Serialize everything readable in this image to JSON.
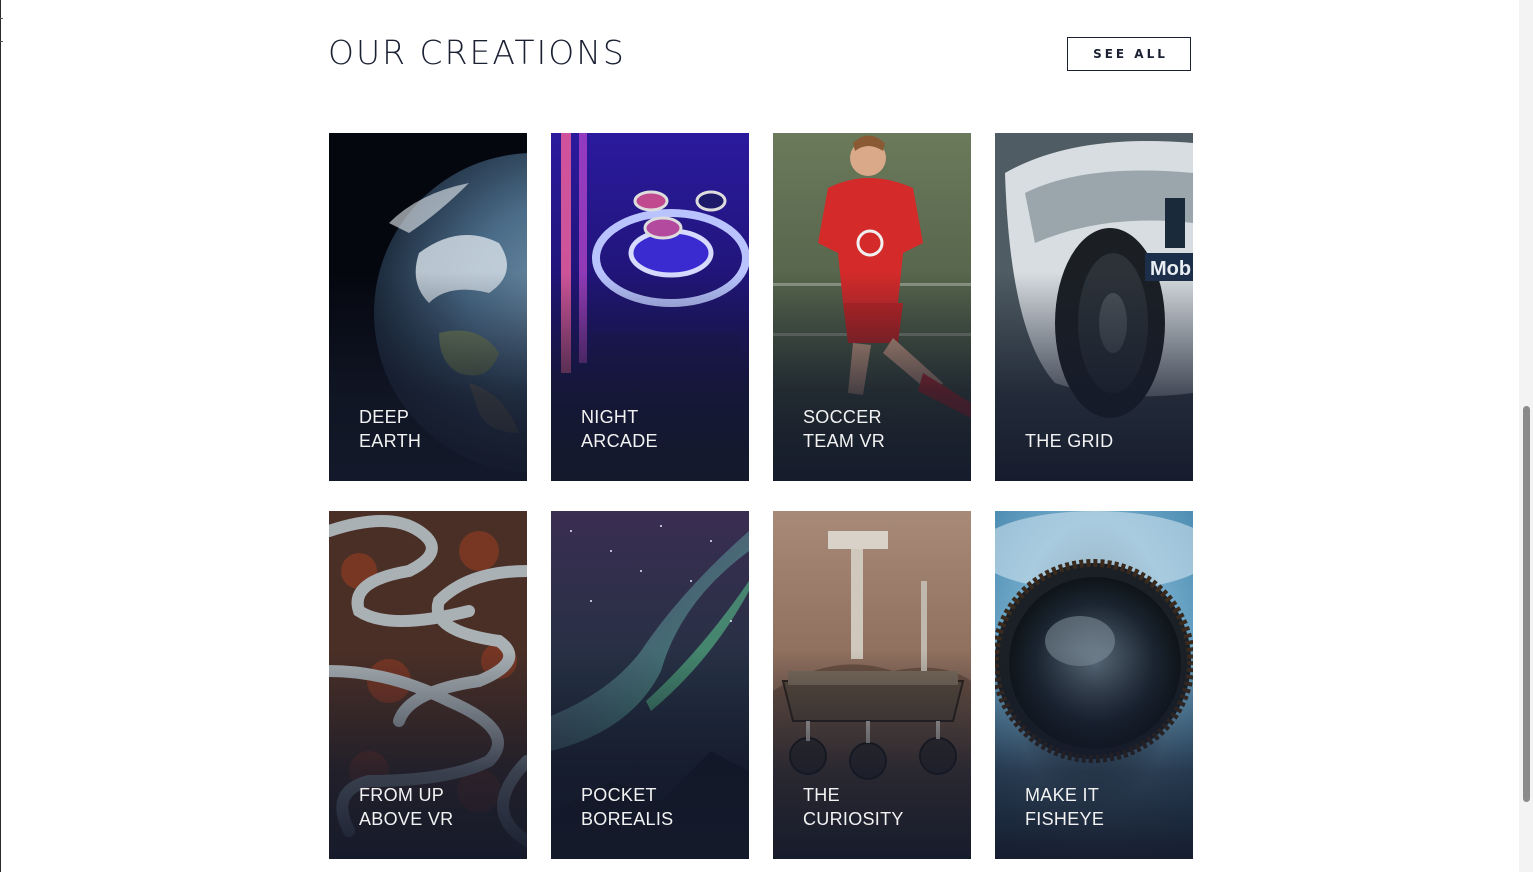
{
  "section": {
    "title": "OUR CREATIONS",
    "see_all_label": "SEE ALL"
  },
  "cards": [
    {
      "line1": "DEEP",
      "line2": "EARTH",
      "image": "earth-from-space"
    },
    {
      "line1": "NIGHT",
      "line2": "ARCADE",
      "image": "skeeball-arcade"
    },
    {
      "line1": "SOCCER",
      "line2": "TEAM VR",
      "image": "soccer-player"
    },
    {
      "line1": "",
      "line2": "THE GRID",
      "image": "race-car"
    },
    {
      "line1": "FROM UP",
      "line2": "ABOVE VR",
      "image": "aerial-winding-road"
    },
    {
      "line1": "POCKET",
      "line2": "BOREALIS",
      "image": "aurora-borealis"
    },
    {
      "line1": "THE",
      "line2": "CURIOSITY",
      "image": "mars-rover"
    },
    {
      "line1": "MAKE IT",
      "line2": "FISHEYE",
      "image": "fisheye-planet"
    }
  ],
  "colors": {
    "text_dark": "#1b2133",
    "card_overlay": "#141a2b"
  }
}
